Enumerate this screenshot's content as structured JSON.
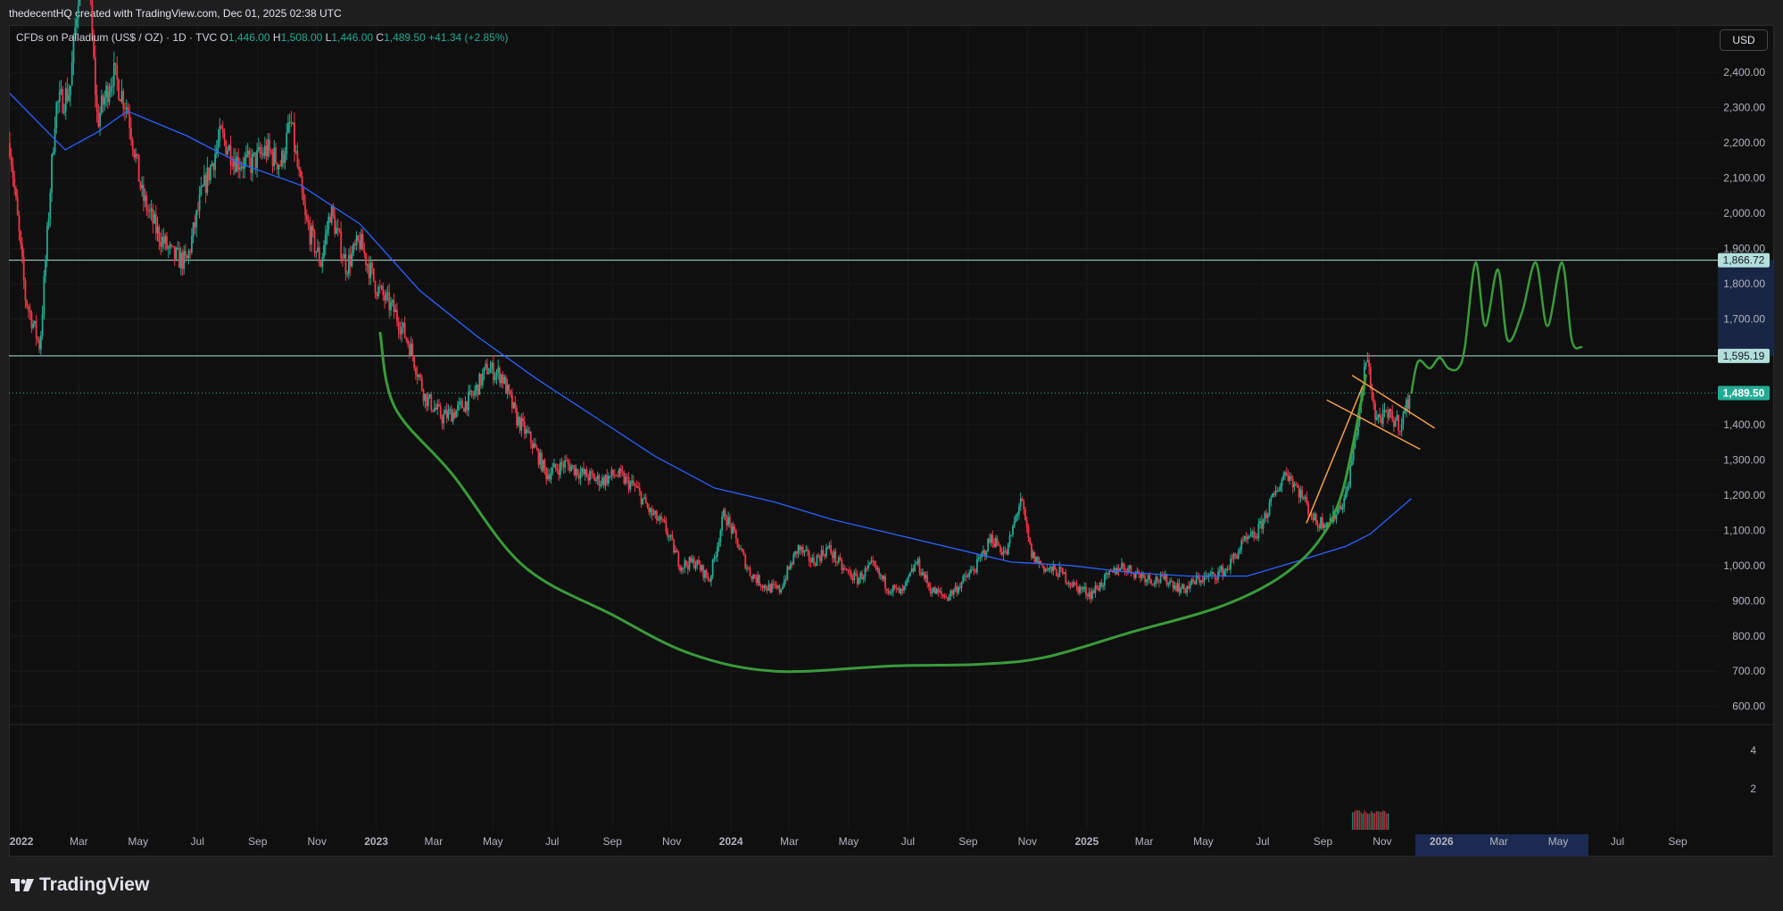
{
  "header": {
    "attribution": "thedecentHQ created with TradingView.com, Dec 01, 2025 02:38 UTC"
  },
  "legend": {
    "symbol": "CFDs on Palladium (US$ / OZ) · 1D · TVC",
    "o_label": "O",
    "o_value": "1,446.00",
    "h_label": "H",
    "h_value": "1,508.00",
    "l_label": "L",
    "l_value": "1,446.00",
    "c_label": "C",
    "c_value": "1,489.50",
    "change": "+41.34 (+2.85%)"
  },
  "currency_button": "USD",
  "logo_text": "TradingView",
  "colors": {
    "up": "#22ab94",
    "down": "#f23645",
    "ma": "#2962ff",
    "drawing_green": "#3a9b3a",
    "drawing_orange": "#f5a04a",
    "hline": "#b2dfdb",
    "price_tag": "#22ab94"
  },
  "chart_data": {
    "type": "candlestick",
    "title": "CFDs on Palladium (US$ / OZ) · 1D · TVC",
    "ylim": [
      560,
      2520
    ],
    "y_ticks": [
      {
        "value": 2400,
        "label": "2,400.00"
      },
      {
        "value": 2300,
        "label": "2,300.00"
      },
      {
        "value": 2200,
        "label": "2,200.00"
      },
      {
        "value": 2100,
        "label": "2,100.00"
      },
      {
        "value": 2000,
        "label": "2,000.00"
      },
      {
        "value": 1900,
        "label": "1,900.00"
      },
      {
        "value": 1800,
        "label": "1,800.00"
      },
      {
        "value": 1700,
        "label": "1,700.00"
      },
      {
        "value": 1400,
        "label": "1,400.00"
      },
      {
        "value": 1300,
        "label": "1,300.00"
      },
      {
        "value": 1200,
        "label": "1,200.00"
      },
      {
        "value": 1100,
        "label": "1,100.00"
      },
      {
        "value": 1000,
        "label": "1,000.00"
      },
      {
        "value": 900,
        "label": "900.00"
      },
      {
        "value": 800,
        "label": "800.00"
      },
      {
        "value": 700,
        "label": "700.00"
      },
      {
        "value": 600,
        "label": "600.00"
      }
    ],
    "price_tags": [
      {
        "value": 1866.72,
        "label": "1,866.72",
        "style": "hline"
      },
      {
        "value": 1595.19,
        "label": "1,595.19",
        "style": "hline"
      },
      {
        "value": 1489.5,
        "label": "1,489.50",
        "style": "last"
      }
    ],
    "x_ticks": [
      {
        "date": "2022-01-01",
        "label": "2022",
        "bold": true
      },
      {
        "date": "2022-03-01",
        "label": "Mar"
      },
      {
        "date": "2022-05-01",
        "label": "May"
      },
      {
        "date": "2022-07-01",
        "label": "Jul"
      },
      {
        "date": "2022-09-01",
        "label": "Sep"
      },
      {
        "date": "2022-11-01",
        "label": "Nov"
      },
      {
        "date": "2023-01-01",
        "label": "2023",
        "bold": true
      },
      {
        "date": "2023-03-01",
        "label": "Mar"
      },
      {
        "date": "2023-05-01",
        "label": "May"
      },
      {
        "date": "2023-07-01",
        "label": "Jul"
      },
      {
        "date": "2023-09-01",
        "label": "Sep"
      },
      {
        "date": "2023-11-01",
        "label": "Nov"
      },
      {
        "date": "2024-01-01",
        "label": "2024",
        "bold": true
      },
      {
        "date": "2024-03-01",
        "label": "Mar"
      },
      {
        "date": "2024-05-01",
        "label": "May"
      },
      {
        "date": "2024-07-01",
        "label": "Jul"
      },
      {
        "date": "2024-09-01",
        "label": "Sep"
      },
      {
        "date": "2024-11-01",
        "label": "Nov"
      },
      {
        "date": "2025-01-01",
        "label": "2025",
        "bold": true
      },
      {
        "date": "2025-03-01",
        "label": "Mar"
      },
      {
        "date": "2025-05-01",
        "label": "May"
      },
      {
        "date": "2025-07-01",
        "label": "Jul"
      },
      {
        "date": "2025-09-01",
        "label": "Sep"
      },
      {
        "date": "2025-11-01",
        "label": "Nov"
      },
      {
        "date": "2026-01-01",
        "label": "2026",
        "bold": true
      },
      {
        "date": "2026-03-01",
        "label": "Mar"
      },
      {
        "date": "2026-05-01",
        "label": "May"
      },
      {
        "date": "2026-07-01",
        "label": "Jul"
      },
      {
        "date": "2026-09-01",
        "label": "Sep"
      }
    ],
    "volume_ticks": [
      {
        "value": 4,
        "label": "4"
      },
      {
        "value": 2,
        "label": "2"
      }
    ],
    "price_path": [
      [
        "2021-12-20",
        2200
      ],
      [
        "2022-01-05",
        1760
      ],
      [
        "2022-01-20",
        1620
      ],
      [
        "2022-02-05",
        2300
      ],
      [
        "2022-02-20",
        2350
      ],
      [
        "2022-03-07",
        2850
      ],
      [
        "2022-03-20",
        2260
      ],
      [
        "2022-04-05",
        2400
      ],
      [
        "2022-04-20",
        2300
      ],
      [
        "2022-05-05",
        2050
      ],
      [
        "2022-05-20",
        1950
      ],
      [
        "2022-06-05",
        1880
      ],
      [
        "2022-06-20",
        1860
      ],
      [
        "2022-07-05",
        2050
      ],
      [
        "2022-07-25",
        2220
      ],
      [
        "2022-08-10",
        2150
      ],
      [
        "2022-08-25",
        2140
      ],
      [
        "2022-09-10",
        2180
      ],
      [
        "2022-09-25",
        2140
      ],
      [
        "2022-10-05",
        2260
      ],
      [
        "2022-10-20",
        1980
      ],
      [
        "2022-11-05",
        1860
      ],
      [
        "2022-11-15",
        2010
      ],
      [
        "2022-12-01",
        1850
      ],
      [
        "2022-12-15",
        1920
      ],
      [
        "2023-01-01",
        1790
      ],
      [
        "2023-01-20",
        1720
      ],
      [
        "2023-02-05",
        1620
      ],
      [
        "2023-02-20",
        1480
      ],
      [
        "2023-03-10",
        1420
      ],
      [
        "2023-03-25",
        1440
      ],
      [
        "2023-04-10",
        1480
      ],
      [
        "2023-04-25",
        1560
      ],
      [
        "2023-05-10",
        1540
      ],
      [
        "2023-05-25",
        1420
      ],
      [
        "2023-06-10",
        1350
      ],
      [
        "2023-06-25",
        1260
      ],
      [
        "2023-07-15",
        1290
      ],
      [
        "2023-08-01",
        1260
      ],
      [
        "2023-08-20",
        1240
      ],
      [
        "2023-09-05",
        1260
      ],
      [
        "2023-09-25",
        1220
      ],
      [
        "2023-10-10",
        1150
      ],
      [
        "2023-10-25",
        1110
      ],
      [
        "2023-11-10",
        1000
      ],
      [
        "2023-11-25",
        1010
      ],
      [
        "2023-12-10",
        960
      ],
      [
        "2023-12-25",
        1150
      ],
      [
        "2024-01-05",
        1080
      ],
      [
        "2024-01-20",
        980
      ],
      [
        "2024-02-05",
        940
      ],
      [
        "2024-02-20",
        930
      ],
      [
        "2024-03-10",
        1050
      ],
      [
        "2024-03-25",
        1010
      ],
      [
        "2024-04-10",
        1050
      ],
      [
        "2024-04-25",
        990
      ],
      [
        "2024-05-10",
        960
      ],
      [
        "2024-05-25",
        1000
      ],
      [
        "2024-06-10",
        940
      ],
      [
        "2024-06-25",
        920
      ],
      [
        "2024-07-10",
        1010
      ],
      [
        "2024-07-25",
        930
      ],
      [
        "2024-08-10",
        910
      ],
      [
        "2024-08-25",
        950
      ],
      [
        "2024-09-10",
        1000
      ],
      [
        "2024-09-25",
        1080
      ],
      [
        "2024-10-10",
        1030
      ],
      [
        "2024-10-25",
        1190
      ],
      [
        "2024-11-05",
        1030
      ],
      [
        "2024-11-20",
        990
      ],
      [
        "2024-12-05",
        980
      ],
      [
        "2024-12-20",
        940
      ],
      [
        "2025-01-05",
        920
      ],
      [
        "2025-01-20",
        960
      ],
      [
        "2025-02-05",
        1000
      ],
      [
        "2025-02-20",
        980
      ],
      [
        "2025-03-10",
        960
      ],
      [
        "2025-03-25",
        960
      ],
      [
        "2025-04-10",
        930
      ],
      [
        "2025-04-25",
        960
      ],
      [
        "2025-05-10",
        970
      ],
      [
        "2025-05-25",
        990
      ],
      [
        "2025-06-10",
        1060
      ],
      [
        "2025-06-25",
        1090
      ],
      [
        "2025-07-10",
        1180
      ],
      [
        "2025-07-25",
        1270
      ],
      [
        "2025-08-10",
        1200
      ],
      [
        "2025-08-25",
        1120
      ],
      [
        "2025-09-10",
        1130
      ],
      [
        "2025-09-25",
        1200
      ],
      [
        "2025-10-10",
        1460
      ],
      [
        "2025-10-16",
        1600
      ],
      [
        "2025-10-25",
        1420
      ],
      [
        "2025-11-10",
        1420
      ],
      [
        "2025-11-20",
        1400
      ],
      [
        "2025-11-30",
        1489.5
      ]
    ],
    "ma_path": [
      [
        "2021-12-20",
        2340
      ],
      [
        "2022-02-15",
        2180
      ],
      [
        "2022-03-20",
        2230
      ],
      [
        "2022-04-20",
        2290
      ],
      [
        "2022-06-20",
        2220
      ],
      [
        "2022-08-15",
        2140
      ],
      [
        "2022-10-15",
        2080
      ],
      [
        "2022-12-15",
        1970
      ],
      [
        "2023-02-15",
        1780
      ],
      [
        "2023-04-15",
        1650
      ],
      [
        "2023-06-15",
        1530
      ],
      [
        "2023-08-15",
        1420
      ],
      [
        "2023-10-15",
        1310
      ],
      [
        "2023-12-15",
        1220
      ],
      [
        "2024-02-15",
        1180
      ],
      [
        "2024-04-15",
        1130
      ],
      [
        "2024-06-15",
        1090
      ],
      [
        "2024-08-15",
        1050
      ],
      [
        "2024-10-15",
        1010
      ],
      [
        "2024-12-15",
        1000
      ],
      [
        "2025-02-15",
        980
      ],
      [
        "2025-04-15",
        970
      ],
      [
        "2025-06-15",
        970
      ],
      [
        "2025-08-15",
        1020
      ],
      [
        "2025-09-25",
        1055
      ],
      [
        "2025-10-20",
        1090
      ],
      [
        "2025-11-10",
        1140
      ],
      [
        "2025-12-01",
        1190
      ]
    ],
    "drawings": {
      "rounding_bottom_curve": [
        [
          "2023-01-05",
          1660
        ],
        [
          "2023-01-20",
          1450
        ],
        [
          "2023-03-20",
          1260
        ],
        [
          "2023-06-01",
          1000
        ],
        [
          "2023-09-01",
          860
        ],
        [
          "2023-11-20",
          750
        ],
        [
          "2024-02-15",
          700
        ],
        [
          "2024-06-15",
          715
        ],
        [
          "2024-09-15",
          720
        ],
        [
          "2024-11-20",
          740
        ],
        [
          "2025-02-15",
          810
        ],
        [
          "2025-05-15",
          880
        ],
        [
          "2025-07-15",
          960
        ],
        [
          "2025-08-25",
          1060
        ],
        [
          "2025-09-20",
          1200
        ],
        [
          "2025-10-10",
          1460
        ],
        [
          "2025-10-15",
          1540
        ]
      ],
      "projection_curve": [
        [
          "2025-12-01",
          1490
        ],
        [
          "2025-12-08",
          1580
        ],
        [
          "2025-12-20",
          1560
        ],
        [
          "2025-12-30",
          1590
        ],
        [
          "2026-01-08",
          1560
        ],
        [
          "2026-01-18",
          1560
        ],
        [
          "2026-01-25",
          1620
        ],
        [
          "2026-02-05",
          1860
        ],
        [
          "2026-02-15",
          1680
        ],
        [
          "2026-02-28",
          1840
        ],
        [
          "2026-03-10",
          1640
        ],
        [
          "2026-03-25",
          1720
        ],
        [
          "2026-04-08",
          1860
        ],
        [
          "2026-04-20",
          1680
        ],
        [
          "2026-05-05",
          1860
        ],
        [
          "2026-05-15",
          1640
        ],
        [
          "2026-05-25",
          1620
        ]
      ],
      "flag_upper": [
        [
          "2025-10-01",
          1540
        ],
        [
          "2025-12-25",
          1390
        ]
      ],
      "flag_lower": [
        [
          "2025-09-05",
          1470
        ],
        [
          "2025-12-10",
          1330
        ]
      ],
      "pole": [
        [
          "2025-08-15",
          1120
        ],
        [
          "2025-10-12",
          1510
        ]
      ]
    }
  }
}
